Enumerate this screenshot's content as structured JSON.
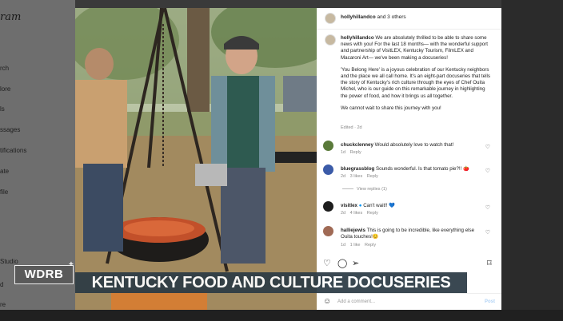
{
  "sidebar": {
    "logo": "ram",
    "items": [
      "rch",
      "lore",
      "ls",
      "ssages",
      "tifications",
      "ate",
      "file",
      "Studio",
      "d",
      "re"
    ]
  },
  "post": {
    "account": "hollyhillandco",
    "coauthors": "and 3 others",
    "caption_user": "hollyhillandco",
    "caption_paragraphs": [
      "We are absolutely thrilled to be able to share some news with you! For the last 18 months— with the wonderful support and partnership of VisitLEX, Kentucky Tourism, FilmLEX and Macaroni Art— we've been making a docuseries!",
      "'You Belong Here' is a joyous celebration of our Kentucky neighbors and the place we all call home. It's an eight-part docuseries that tells the story of Kentucky's rich culture through the eyes of Chef Ouita Michel, who is our guide on this remarkable journey in highlighting the power of food, and how it brings us all together.",
      "We cannot wait to share this journey with you!"
    ],
    "edited": "Edited · 2d",
    "view_replies": "View replies (1)",
    "add_comment_placeholder": "Add a comment...",
    "post_button": "Post"
  },
  "comments": [
    {
      "user": "chuckclenney",
      "text": "Would absolutely love to watch that!",
      "time": "1d",
      "likes": "",
      "reply": "Reply",
      "avatar_color": "#5a7a3a"
    },
    {
      "user": "bluegrassblog",
      "text": "Sounds wonderful. Is that tomato pie?!! 🍅",
      "time": "2d",
      "likes": "3 likes",
      "reply": "Reply",
      "avatar_color": "#3b5ba8"
    },
    {
      "user": "visitlex",
      "text": "Can't wait!! 💙",
      "time": "2d",
      "likes": "4 likes",
      "reply": "Reply",
      "avatar_color": "#1d1d1d"
    },
    {
      "user": "halliejewis",
      "text": "This is going to be incredible, like everything else Ouita touches!😊",
      "time": "1d",
      "likes": "1 like",
      "reply": "Reply",
      "avatar_color": "#a06a55"
    }
  ],
  "broadcast": {
    "station": "WDRB",
    "station_plus": "+",
    "headline": "KENTUCKY FOOD AND CULTURE DOCUSERIES"
  },
  "icons": [
    "heart-icon",
    "comment-icon",
    "share-icon",
    "bookmark-icon",
    "emoji-icon",
    "verified-icon"
  ],
  "colors": {
    "chyron": "#2c3b45",
    "link_blue": "#0095f6"
  }
}
